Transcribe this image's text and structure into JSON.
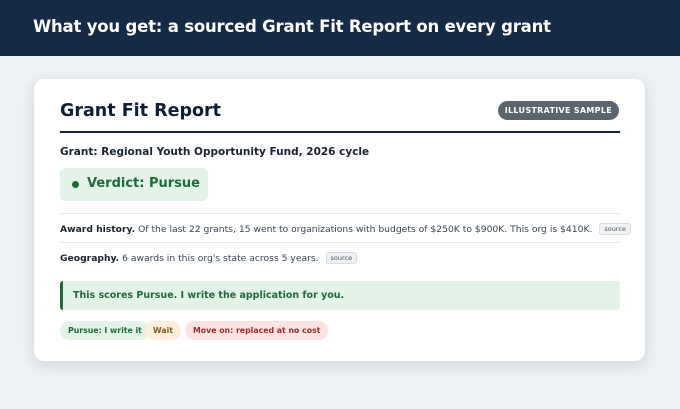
{
  "header": {
    "title": "What you get: a sourced Grant Fit Report on every grant"
  },
  "report": {
    "title": "Grant Fit Report",
    "badge": "ILLUSTRATIVE SAMPLE",
    "grant_name": "Grant: Regional Youth Opportunity Fund, 2026 cycle",
    "verdict": "Verdict: Pursue",
    "evidence": [
      {
        "label": "Award history.",
        "text": "Of the last 22 grants, 15 went to organizations with budgets of $250K to $900K. This org is $410K.",
        "source": "source"
      },
      {
        "label": "Geography.",
        "text": "6 awards in this org's state across 5 years.",
        "source": "source"
      }
    ],
    "callout": "This scores Pursue. I write the application for you.",
    "pills": [
      {
        "label": "Pursue: I write it"
      },
      {
        "label": "Wait"
      },
      {
        "label": "Move on: replaced at no cost"
      }
    ]
  },
  "colors": {
    "header_bg": "#152a44",
    "pursue_green": "#1e6b3a",
    "pursue_bg": "#e3f3e7",
    "wait_bg": "#fdeedd",
    "moveon_bg": "#fbe3e3"
  }
}
